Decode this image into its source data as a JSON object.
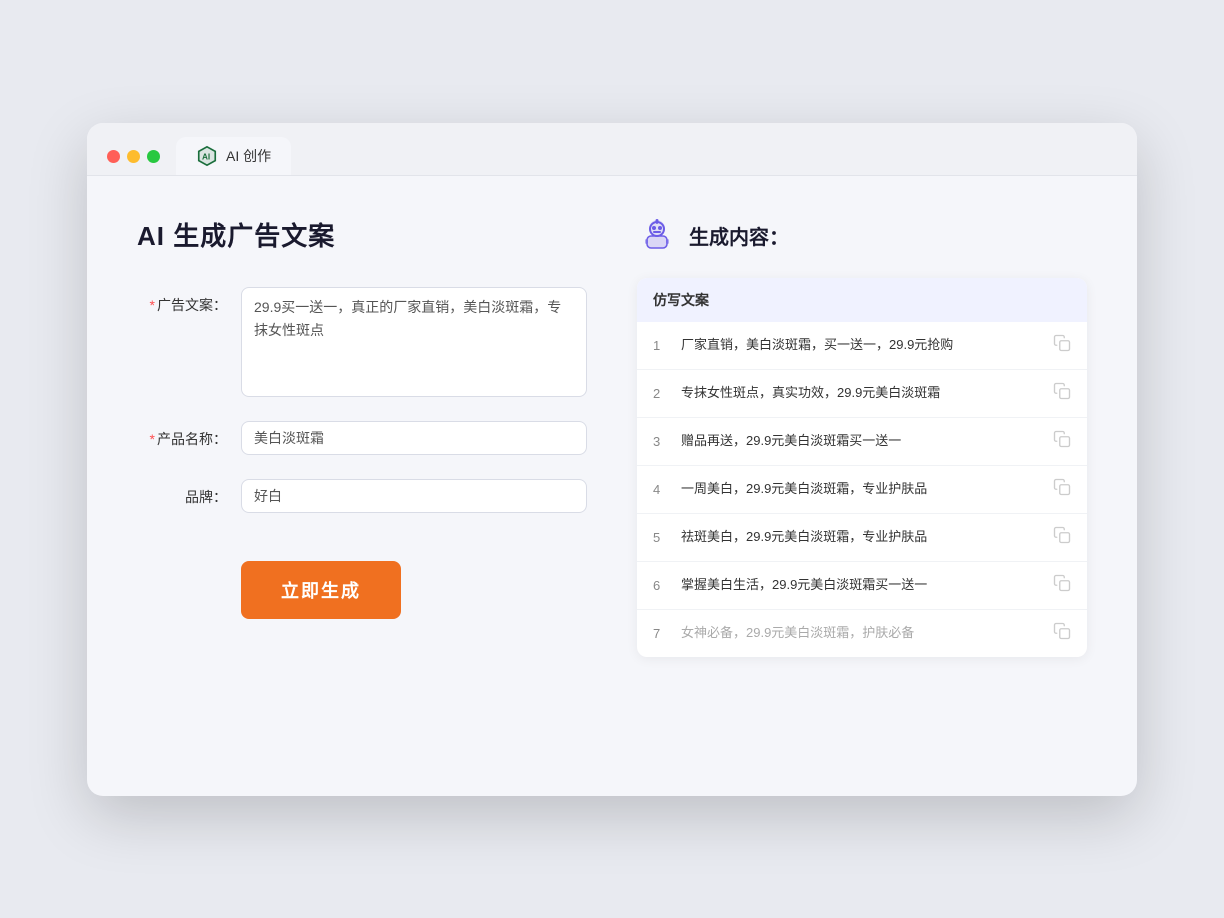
{
  "tab": {
    "label": "AI 创作"
  },
  "left": {
    "title": "AI 生成广告文案",
    "fields": [
      {
        "id": "ad-copy",
        "label": "广告文案：",
        "required": true,
        "type": "textarea",
        "value": "29.9买一送一，真正的厂家直销，美白淡斑霜，专抹女性斑点"
      },
      {
        "id": "product-name",
        "label": "产品名称：",
        "required": true,
        "type": "input",
        "value": "美白淡斑霜"
      },
      {
        "id": "brand",
        "label": "品牌：",
        "required": false,
        "type": "input",
        "value": "好白"
      }
    ],
    "button_label": "立即生成"
  },
  "right": {
    "title": "生成内容：",
    "table_header": "仿写文案",
    "items": [
      {
        "num": "1",
        "text": "厂家直销，美白淡斑霜，买一送一，29.9元抢购",
        "muted": false
      },
      {
        "num": "2",
        "text": "专抹女性斑点，真实功效，29.9元美白淡斑霜",
        "muted": false
      },
      {
        "num": "3",
        "text": "赠品再送，29.9元美白淡斑霜买一送一",
        "muted": false
      },
      {
        "num": "4",
        "text": "一周美白，29.9元美白淡斑霜，专业护肤品",
        "muted": false
      },
      {
        "num": "5",
        "text": "祛斑美白，29.9元美白淡斑霜，专业护肤品",
        "muted": false
      },
      {
        "num": "6",
        "text": "掌握美白生活，29.9元美白淡斑霜买一送一",
        "muted": false
      },
      {
        "num": "7",
        "text": "女神必备，29.9元美白淡斑霜，护肤必备",
        "muted": true
      }
    ]
  }
}
